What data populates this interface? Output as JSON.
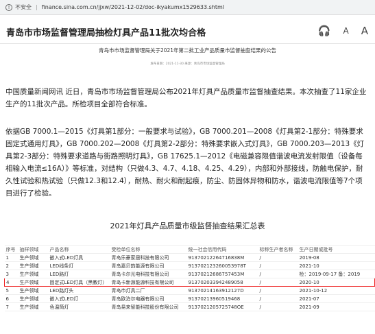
{
  "browser": {
    "security_label": "不安全",
    "url": "finance.sina.com.cn/jjxw/2021-12-02/doc-ikyakumx1529633.shtml"
  },
  "header": {
    "title": "青岛市市场监督管理局抽检灯具产品11批次均合格",
    "tools": {
      "listen": "🎧",
      "font_small": "A",
      "font_large": "A"
    }
  },
  "article": {
    "subtitle": "青岛市市场监督管理局关于2021年第二批工业产品质量市监督抽查结果的公告",
    "meta": "发布日期：2021-11-30  来源：青岛市市场监督管理局",
    "paragraph1": "中国质量新闻网讯 近日，青岛市市场监督管理局公布2021年灯具产品质量市监督抽查结果。本次抽查了11家企业生产的11批次产品。所检项目全部符合标准。",
    "paragraph2": "依据GB 7000.1—2015《灯具第1部分：一般要求与试验》，GB 7000.201—2008《灯具第2-1部分：特殊要求固定式通用灯具》，GB 7000.202—2008《灯具第2-2部分：特殊要求嵌入式灯具》，GB 7000.203—2013《灯具第2-3部分：特殊要求道路与街路照明灯具》，GB 17625.1—2012《电磁兼容限值谐波电流发射限值（设备每相输入电流≤16A）》等标准，对结构（只做4.3、4.7、4.18、4.25、4.29），内部和外部接线，防触电保护，耐久性试验和热试验（只做12.3和12.4），耐热、耐火和耐起痕，防尘、防固体异物和防水，谐波电流限值等7个项目进行了检验。"
  },
  "table": {
    "title": "2021年灯具产品质量市级监督抽查结果汇总表",
    "headers": [
      "序号",
      "抽样领域",
      "产品名称",
      "受检单位名称",
      "统一社会信用代码",
      "标称生产者名称",
      "生产日期或批号"
    ],
    "rows": [
      [
        "1",
        "生产领域",
        "嵌入式LED灯具",
        "青岛乐豪家居科技有限公司",
        "91370212264716838M",
        "/",
        "2019-08"
      ],
      [
        "2",
        "生产领域",
        "LED线条灯",
        "青岛嘉贝韵能源有限公司",
        "913702123260053978T",
        "/",
        "2021-10"
      ],
      [
        "3",
        "生产领域",
        "LED路灯",
        "青岛卡尔光电科技有限公司",
        "91370212686757453M",
        "/",
        "检：2019-09-17 备：2019"
      ],
      [
        "4",
        "生产领域",
        "固定式LED灯具（黑教灯）",
        "青岛卡新源能源科技有限公司",
        "913702033942489058",
        "/",
        "2020-10"
      ],
      [
        "5",
        "生产领域",
        "LED路灯头",
        "青岛市灯具二厂",
        "91370214163912127D",
        "/",
        "2021-10-12"
      ],
      [
        "6",
        "生产领域",
        "嵌入式LED灯",
        "青岛欧泊尔电器有限公司",
        "91370213960519468",
        "/",
        "2021-07"
      ],
      [
        "7",
        "生产领域",
        "色温筒灯",
        "青岛易来智能科技股份有限公司",
        "9137021205725748OE",
        "/",
        "2021-09"
      ]
    ],
    "highlighted_row": 4,
    "highlight_color": "#ee2222"
  }
}
